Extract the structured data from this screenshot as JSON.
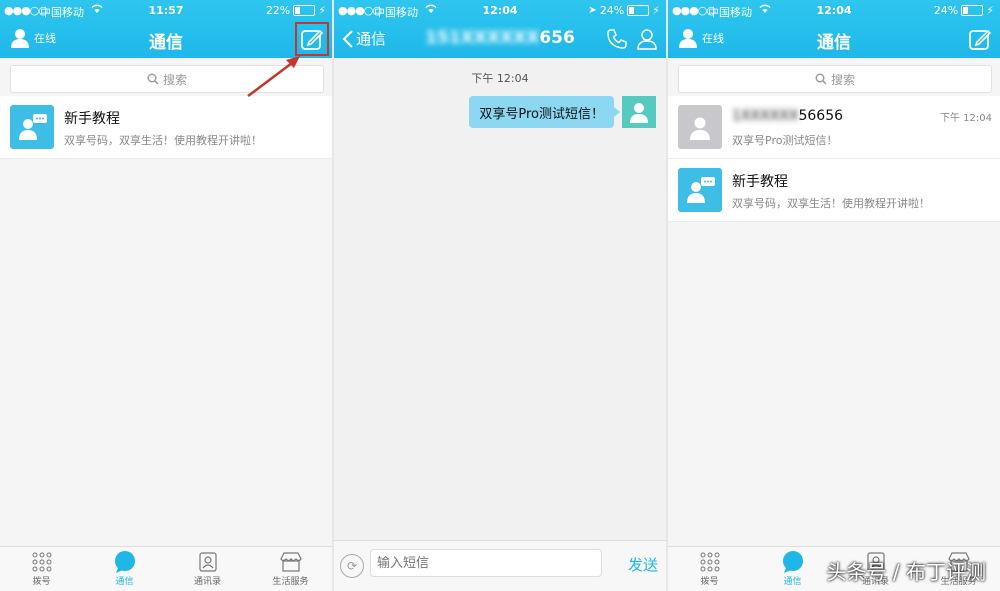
{
  "screens": [
    {
      "status": {
        "carrier": "中国移动",
        "time": "11:57",
        "battery": "22%",
        "battery_level": 0.22
      },
      "nav": {
        "online_label": "在线",
        "title": "通信"
      },
      "search": {
        "placeholder": "搜索"
      },
      "conversations": [
        {
          "name": "新手教程",
          "preview": "双享号码，双享生活！使用教程开讲啦！",
          "time": ""
        }
      ],
      "compose_highlighted": true
    },
    {
      "status": {
        "carrier": "中国移动",
        "time": "12:04",
        "battery": "24%",
        "battery_level": 0.24
      },
      "nav": {
        "back_label": "通信",
        "title_prefix": "151",
        "title_blurred": "XXXXXX",
        "title_suffix": "656"
      },
      "chat": {
        "timestamp": "下午 12:04",
        "messages": [
          {
            "text": "双享号Pro测试短信！",
            "from": "me"
          }
        ]
      },
      "input": {
        "placeholder": "输入短信",
        "send_label": "发送"
      }
    },
    {
      "status": {
        "carrier": "中国移动",
        "time": "12:04",
        "battery": "24%",
        "battery_level": 0.24
      },
      "nav": {
        "online_label": "在线",
        "title": "通信"
      },
      "search": {
        "placeholder": "搜索"
      },
      "conversations": [
        {
          "name_prefix": "1",
          "name_blurred": "XXXXXX",
          "name_suffix": "56656",
          "preview": "双享号Pro测试短信！",
          "time": "下午 12:04"
        },
        {
          "name": "新手教程",
          "preview": "双享号码，双享生活！使用教程开讲啦！",
          "time": ""
        }
      ]
    }
  ],
  "tabs": [
    {
      "label": "拨号",
      "icon": "dialpad-icon"
    },
    {
      "label": "通信",
      "icon": "chat-bubble-icon"
    },
    {
      "label": "通讯录",
      "icon": "contacts-book-icon"
    },
    {
      "label": "生活服务",
      "icon": "shop-icon"
    }
  ],
  "watermark": "头条号 / 布丁评测",
  "colors": {
    "accent": "#1fb7e8",
    "bubble": "#8cd8f2",
    "highlight": "#c0392b"
  }
}
